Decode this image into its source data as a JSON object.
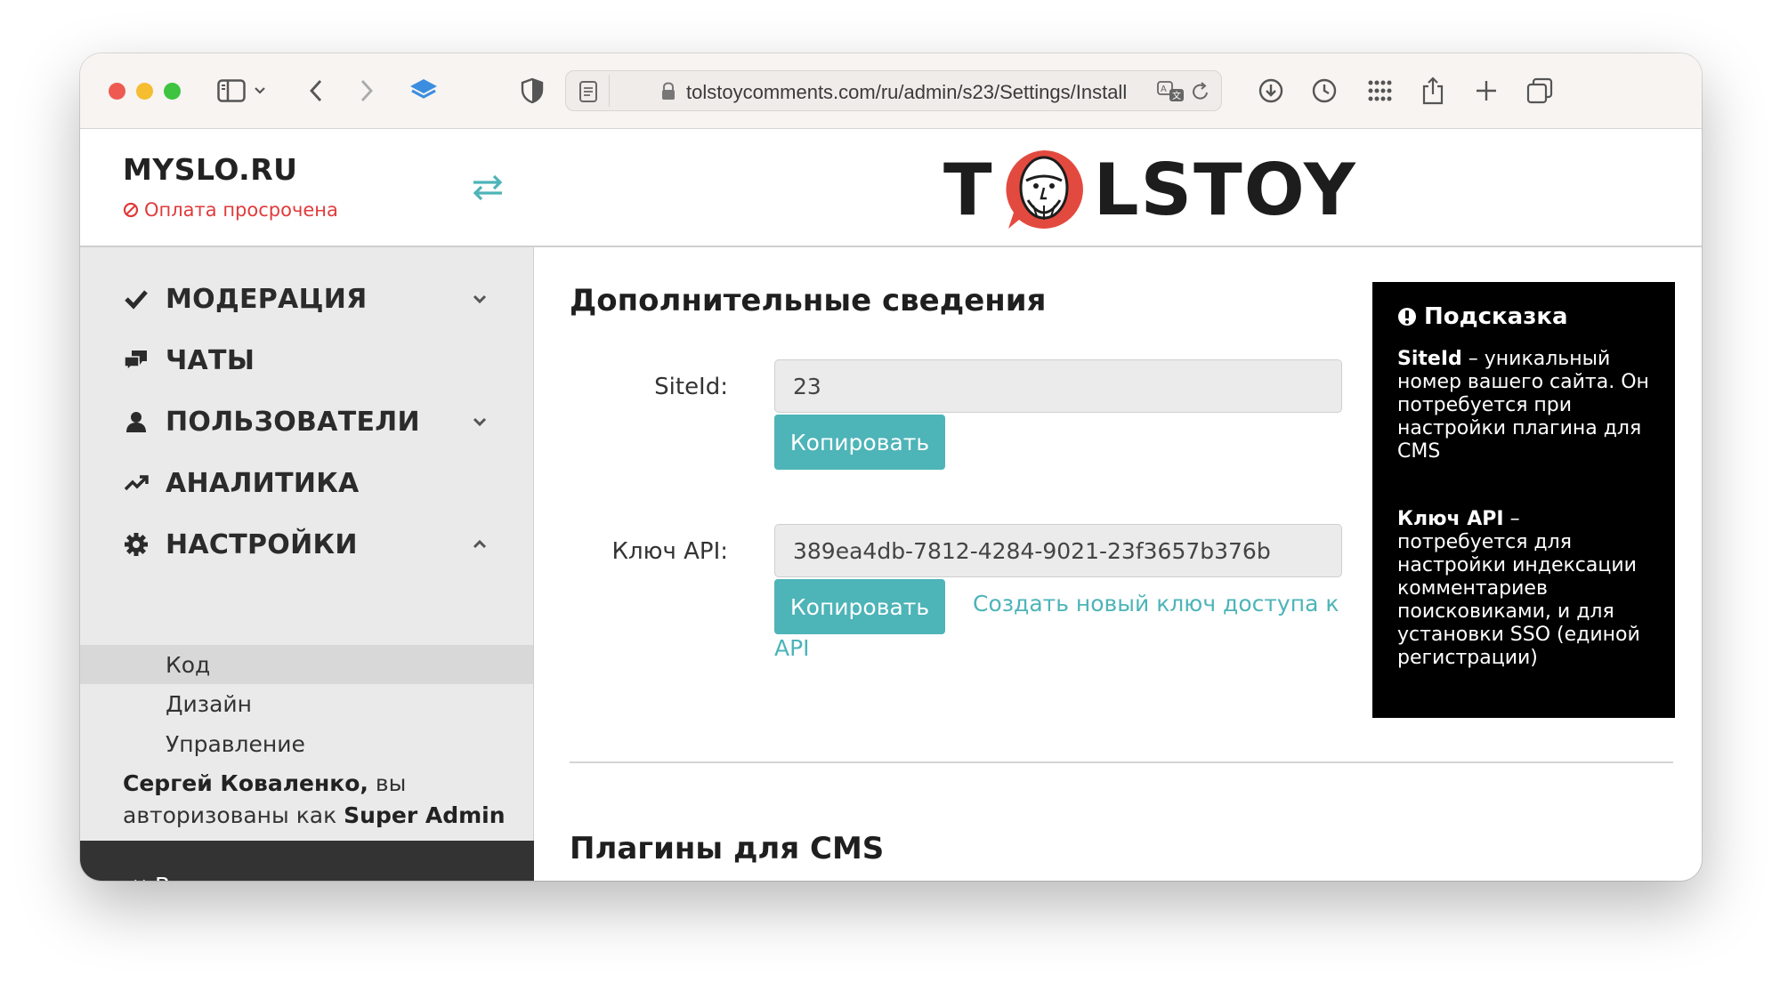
{
  "browser": {
    "url": "tolstoycomments.com/ru/admin/s23/Settings/Install",
    "colors": {
      "close": "#ee5a52",
      "minimize": "#f5bd2f",
      "zoom": "#3ec440"
    }
  },
  "sidebar": {
    "site_name": "MYSLO.RU",
    "site_status": "Оплата просрочена",
    "nav": [
      {
        "label": "МОДЕРАЦИЯ",
        "icon": "check-icon",
        "chevron": "down"
      },
      {
        "label": "ЧАТЫ",
        "icon": "chat-bubbles-icon"
      },
      {
        "label": "ПОЛЬЗОВАТЕЛИ",
        "icon": "user-icon",
        "chevron": "down"
      },
      {
        "label": "АНАЛИТИКА",
        "icon": "trend-up-icon"
      },
      {
        "label": "НАСТРОЙКИ",
        "icon": "gear-icon",
        "chevron": "up"
      }
    ],
    "settings_sub": [
      {
        "label": "Код",
        "active": true
      },
      {
        "label": "Дизайн"
      },
      {
        "label": "Управление"
      }
    ],
    "user": {
      "name": "Сергей Коваленко,",
      "text_mid": " вы авторизованы как ",
      "role": "Super Admin"
    },
    "logout_label": "Выход"
  },
  "main": {
    "logo_left": "T",
    "logo_right": "LSTOY",
    "section_title": "Дополнительные сведения",
    "fields": [
      {
        "label": "SiteId:",
        "value": "23",
        "button": "Копировать"
      },
      {
        "label": "Ключ API:",
        "value": "389ea4db-7812-4284-9021-23f3657b376b",
        "button": "Копировать"
      }
    ],
    "new_key_link_line1": "Создать новый ключ доступа к",
    "new_key_link_line2": "API",
    "plugins_title": "Плагины для CMS"
  },
  "hint": {
    "title": "Подсказка",
    "siteid_term": "SiteId",
    "siteid_text": " – уникальный номер вашего сайта. Он потребуется при настройки плагина для CMS",
    "api_term": "Ключ API",
    "api_text": " – потребуется для настройки индексации комментариев поисковиками, и для установки SSO (единой регистрации)"
  },
  "colors": {
    "accent": "#4db4b8",
    "error": "#e03b3b",
    "logo_red": "#e34a3f"
  }
}
